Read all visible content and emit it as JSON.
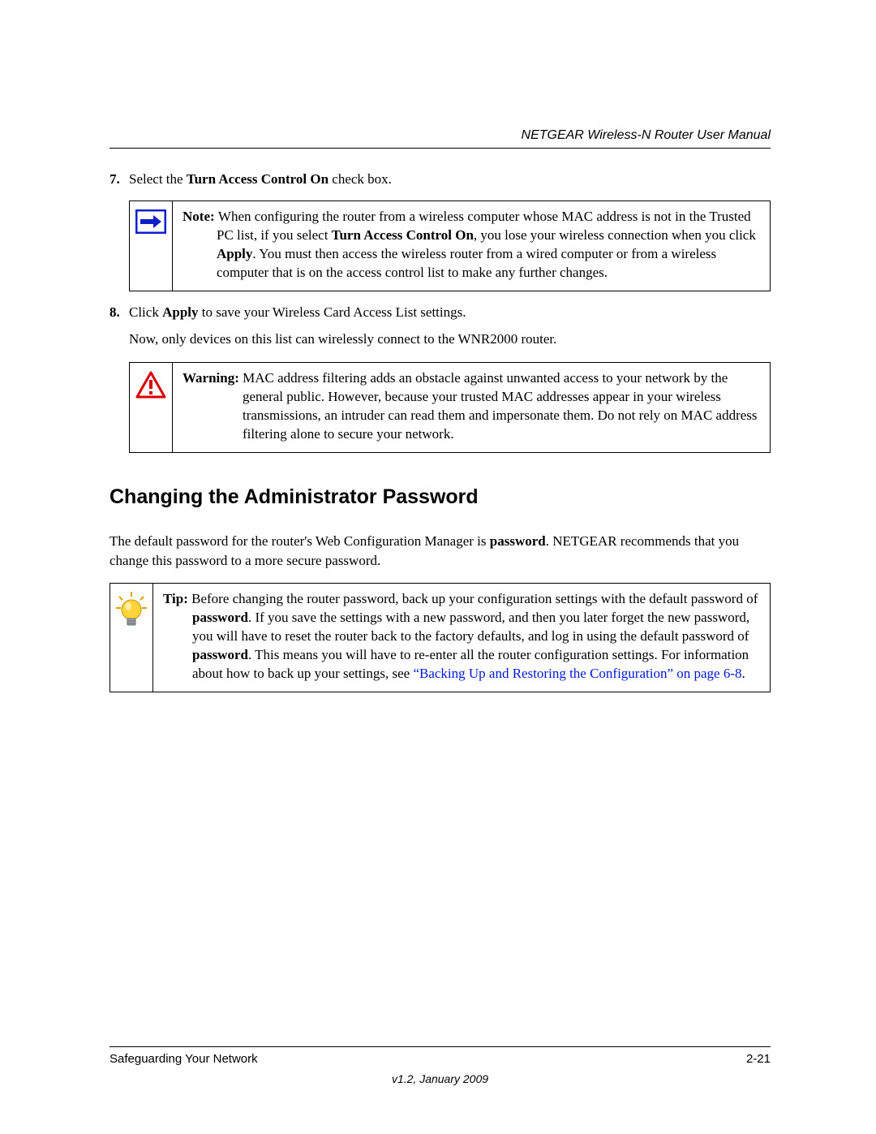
{
  "header": {
    "title": "NETGEAR Wireless-N Router User Manual"
  },
  "step7": {
    "num": "7.",
    "pre": "Select the ",
    "bold": "Turn Access Control On",
    "post": " check box."
  },
  "note": {
    "label": "Note: ",
    "t1": "When configuring the router from a wireless computer whose MAC address is not in the Trusted PC list, if you select ",
    "b1": "Turn Access Control On",
    "t2": ", you lose your wireless connection when you click ",
    "b2": "Apply",
    "t3": ". You must then access the wireless router from a wired computer or from a wireless computer that is on the access control list to make any further changes."
  },
  "step8": {
    "num": "8.",
    "pre": "Click ",
    "bold": "Apply",
    "post": " to save your Wireless Card Access List settings.",
    "follow": "Now, only devices on this list can wirelessly connect to the WNR2000 router."
  },
  "warning": {
    "label": "Warning: ",
    "text": "MAC address filtering adds an obstacle against unwanted access to your network by the general public. However, because your trusted MAC addresses appear in your wireless transmissions, an intruder can read them and impersonate them. Do not rely on MAC address filtering alone to secure your network."
  },
  "heading": "Changing the Administrator Password",
  "para": {
    "t1": "The default password for the router's Web Configuration Manager is ",
    "b1": "password",
    "t2": ". NETGEAR recommends that you change this password to a more secure password."
  },
  "tip": {
    "label": "Tip: ",
    "t1": "Before changing the router password, back up your configuration settings with the default password of ",
    "b1": "password",
    "t2": ". If you save the settings with a new password, and then you later forget the new password, you will have to reset the router back to the factory defaults, and log in using the default password of ",
    "b2": "password",
    "t3": ". This means you will have to re-enter all the router configuration settings. For information about how to back up your settings, see ",
    "link": "“Backing Up and Restoring the Configuration” on page 6-8",
    "t4": "."
  },
  "footer": {
    "left": "Safeguarding Your Network",
    "right": "2-21",
    "version": "v1.2, January 2009"
  }
}
